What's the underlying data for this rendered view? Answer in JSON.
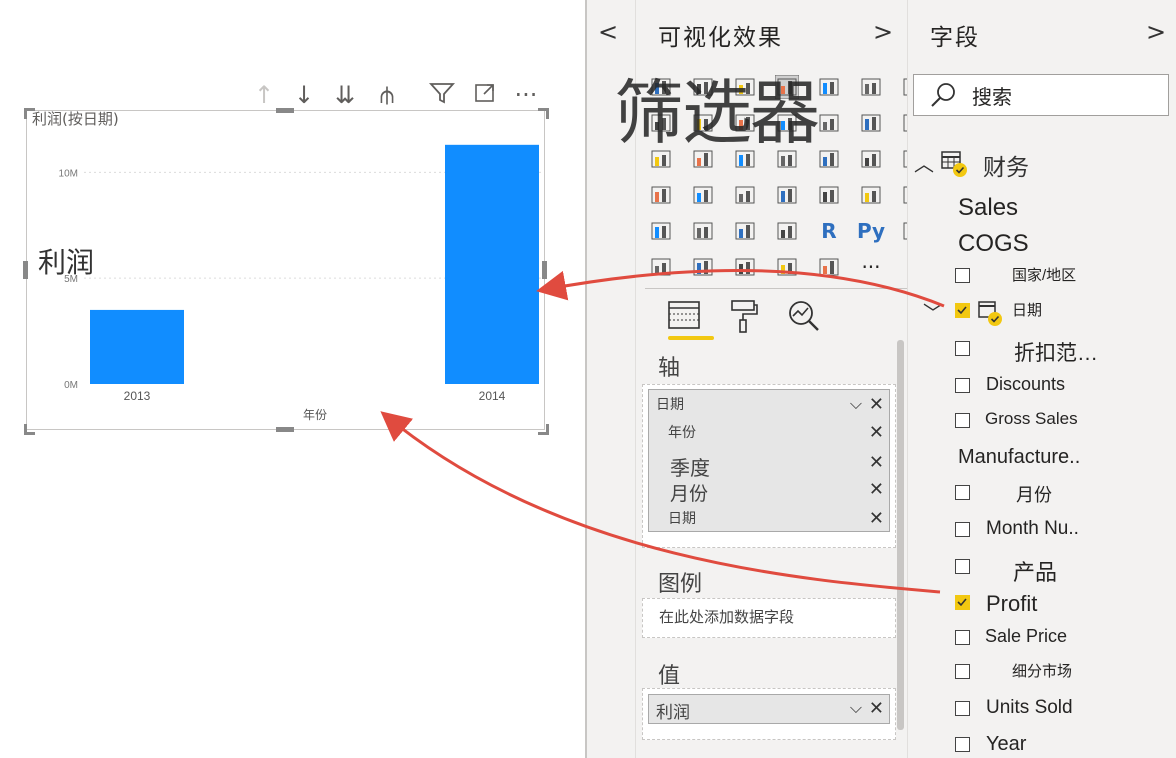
{
  "chart": {
    "title": "利润(按日期)",
    "toolbar": [
      "↑",
      "↓",
      "⇊",
      "⫛",
      "filter",
      "focus",
      "···"
    ]
  },
  "callouts": {
    "lirun": "利润",
    "filter": "筛选器"
  },
  "chart_data": {
    "type": "bar",
    "categories": [
      "2013",
      "2014"
    ],
    "values": [
      3.5,
      11.3
    ],
    "xlabel": "年份",
    "ylabel": "",
    "y_ticks": [
      "0M",
      "5M",
      "10M"
    ],
    "ylim": [
      0,
      12
    ],
    "grid": true,
    "bar_color": "#118dff"
  },
  "viz_pane": {
    "collapse": "<",
    "title": "可视化效果",
    "expand": ">",
    "icon_glyphs": [
      "R",
      "Py",
      "···"
    ],
    "wells": {
      "axis_label": "轴",
      "axis_fields": [
        "日期",
        "年份",
        "季度",
        "月份",
        "日期"
      ],
      "legend_label": "图例",
      "legend_placeholder": "在此处添加数据字段",
      "values_label": "值",
      "values_fields": [
        "利润"
      ]
    }
  },
  "fields_pane": {
    "title": "字段",
    "expand": ">",
    "search_label": "搜索",
    "table_name": "财务",
    "items": [
      {
        "label": "Sales",
        "checked": null
      },
      {
        "label": "COGS",
        "checked": null
      },
      {
        "label": "国家/地区",
        "checked": false
      },
      {
        "label": "日期",
        "checked": true
      },
      {
        "label": "折扣范…",
        "checked": false
      },
      {
        "label": "Discounts",
        "checked": false
      },
      {
        "label": "Gross Sales",
        "checked": false
      },
      {
        "label": "Manufacture..",
        "checked": null
      },
      {
        "label": "月份",
        "checked": false
      },
      {
        "label": "Month Nu..",
        "checked": false
      },
      {
        "label": "产品",
        "checked": false
      },
      {
        "label": "Profit",
        "checked": true
      },
      {
        "label": "Sale Price",
        "checked": false
      },
      {
        "label": "细分市场",
        "checked": false
      },
      {
        "label": "Units Sold",
        "checked": false
      },
      {
        "label": "Year",
        "checked": false
      }
    ]
  },
  "colors": {
    "accent": "#f2c811",
    "bar": "#118dff",
    "arrow": "#e04b3f"
  }
}
